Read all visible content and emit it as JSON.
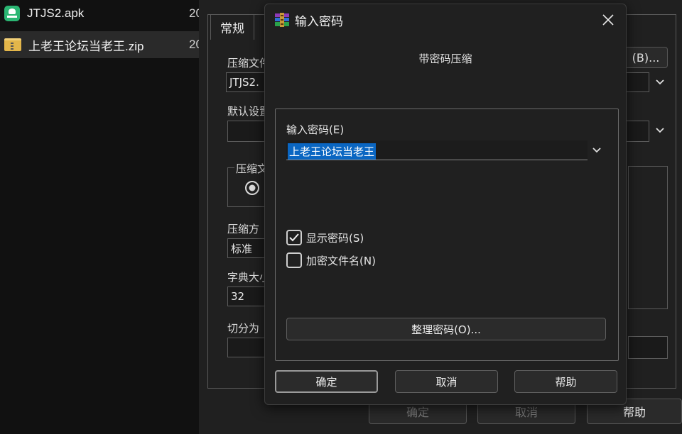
{
  "file_list": {
    "items": [
      {
        "name": "JTJS2.apk",
        "date": "20",
        "icon": "apk-icon"
      },
      {
        "name": "上老王论坛当老王.zip",
        "date": "20",
        "icon": "zip-archive-icon"
      }
    ]
  },
  "archive_dialog": {
    "tab_general": "常规",
    "archive_name_label": "压缩文件",
    "archive_name_value": "JTJS2.",
    "browse_label": "(B)...",
    "default_profile_label": "默认设置",
    "archive_format_label": "压缩文",
    "compression_method_label": "压缩方",
    "compression_method_value": "标准",
    "dictionary_size_label": "字典大小",
    "dictionary_size_value": "32",
    "split_label": "切分为",
    "ok_label": "确定",
    "cancel_label": "取消",
    "help_label": "帮助"
  },
  "password_dialog": {
    "title": "输入密码",
    "subtitle": "带密码压缩",
    "password_label": "输入密码(E)",
    "password_value": "上老王论坛当老王",
    "show_password_label": "显示密码(S)",
    "show_password_checked": true,
    "encrypt_names_label": "加密文件名(N)",
    "encrypt_names_checked": false,
    "organize_button": "整理密码(O)...",
    "ok_button": "确定",
    "cancel_button": "取消",
    "help_button": "帮助"
  }
}
